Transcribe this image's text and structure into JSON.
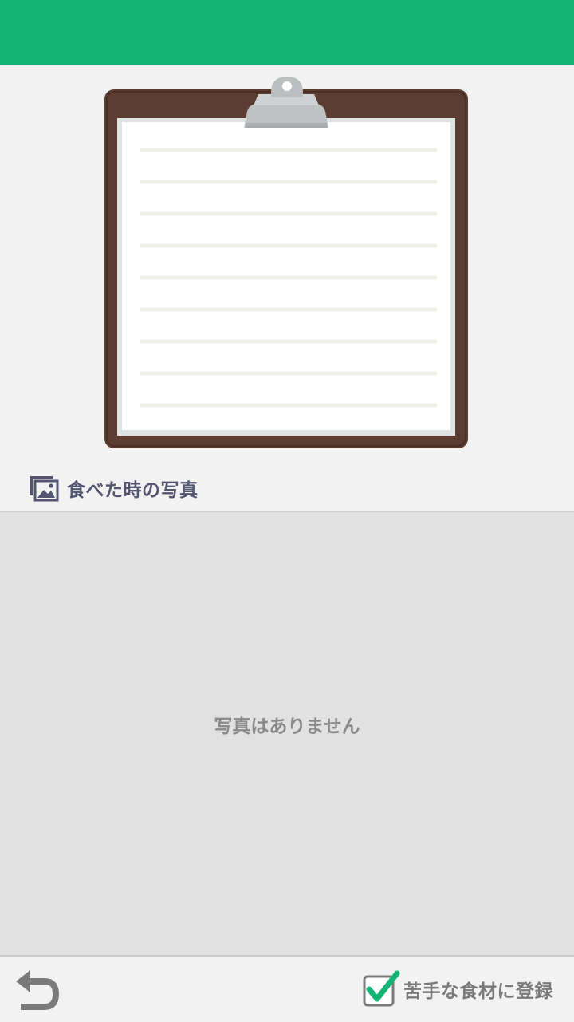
{
  "header": {
    "color": "#13b474"
  },
  "clipboard": {
    "icon": "clipboard-illustration",
    "board_color": "#5b3d31",
    "line_color": "#efefe8"
  },
  "photo_section": {
    "icon": "image-icon",
    "title": "食べた時の写真",
    "empty_message": "写真はありません"
  },
  "footer": {
    "back_icon": "back-arrow-icon",
    "dislike_checkbox": {
      "label": "苦手な食材に登録",
      "checked": true,
      "check_color": "#13b474"
    }
  }
}
